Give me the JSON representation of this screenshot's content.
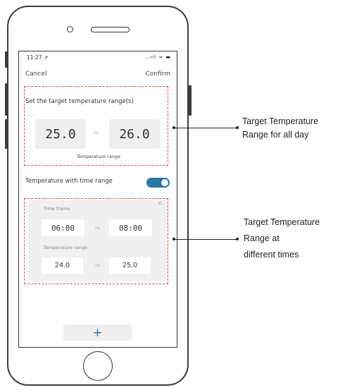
{
  "status_bar": {
    "time": "11:27 ↗",
    "indicators": "…ııl ≈ ▬"
  },
  "nav": {
    "cancel_label": "Cancel",
    "confirm_label": "Confirm"
  },
  "all_day": {
    "title": "Set the target temperature range(s)",
    "low": "25.0",
    "high": "26.0",
    "caption": "Temperature range"
  },
  "time_range_toggle": {
    "label": "Temperature with time range",
    "enabled": true
  },
  "time_card": {
    "time_frame_label": "Time frame",
    "start_time": "06:00",
    "end_time": "08:00",
    "temp_label": "Temperature range",
    "low": "24.0",
    "high": "25.0"
  },
  "add_button_label": "+",
  "annotations": {
    "all_day_lines": [
      "Target Temperature",
      "Range for all day"
    ],
    "times_lines": [
      "Target Temperature",
      "Range at",
      "different times"
    ]
  },
  "colors": {
    "accent": "#2a76a6",
    "dash": "#e0484d",
    "box": "#eeeeee"
  },
  "icons": {
    "swap": "swap-icon",
    "close": "close-icon",
    "add": "plus-icon"
  }
}
